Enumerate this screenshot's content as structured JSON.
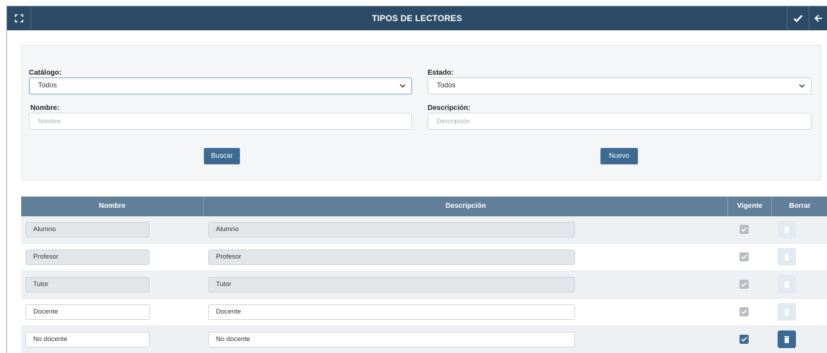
{
  "header": {
    "title": "TIPOS DE LECTORES"
  },
  "filters": {
    "catalogo": {
      "label": "Catálogo:",
      "value": "Todos"
    },
    "estado": {
      "label": "Estado:",
      "value": "Todos"
    },
    "nombre": {
      "label": "Nombre:",
      "placeholder": "Nombre"
    },
    "descripcion": {
      "label": "Descripción:",
      "placeholder": "Descripción"
    },
    "buscar_label": "Buscar",
    "nuevo_label": "Nuevo"
  },
  "table": {
    "columns": [
      "Nombre",
      "Descripción",
      "Vigente",
      "Borrar"
    ],
    "rows": [
      {
        "nombre": "Alumno",
        "descripcion": "Alumno",
        "vigente": true,
        "editable": false
      },
      {
        "nombre": "Profesor",
        "descripcion": "Profesor",
        "vigente": true,
        "editable": false
      },
      {
        "nombre": "Tutor",
        "descripcion": "Tutor",
        "vigente": true,
        "editable": false
      },
      {
        "nombre": "Docente",
        "descripcion": "Docente",
        "vigente": true,
        "editable": true
      },
      {
        "nombre": "No docente",
        "descripcion": "No docente",
        "vigente": true,
        "editable": true
      }
    ]
  },
  "colors": {
    "header_bg": "#2b4b66",
    "table_header_bg": "#617f99",
    "button_bg": "#3d6a91"
  }
}
